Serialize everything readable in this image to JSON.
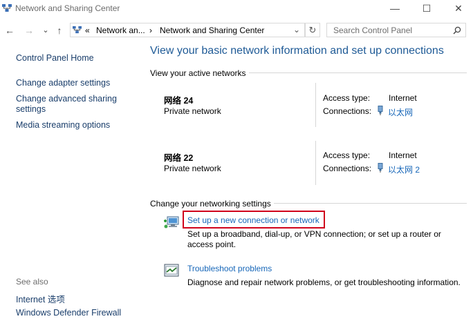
{
  "window": {
    "title": "Network and Sharing Center",
    "min_glyph": "—",
    "max_glyph": "☐",
    "close_glyph": "✕"
  },
  "nav": {
    "back_glyph": "←",
    "forward_glyph": "→",
    "recent_glyph": "⌄",
    "up_glyph": "↑",
    "address_prefix": "«",
    "breadcrumb_1": "Network an...",
    "sep": "›",
    "breadcrumb_2": "Network and Sharing Center",
    "dropdown_glyph": "⌄",
    "refresh_glyph": "↻",
    "search_placeholder": "Search Control Panel"
  },
  "sidebar": {
    "home": "Control Panel Home",
    "items": [
      "Change adapter settings",
      "Change advanced sharing settings",
      "Media streaming options"
    ],
    "see_also_label": "See also",
    "see_also": [
      "Internet 选项",
      "Windows Defender Firewall"
    ]
  },
  "main": {
    "heading": "View your basic network information and set up connections",
    "active_label": "View your active networks",
    "networks": [
      {
        "name": "网络 24",
        "type": "Private network",
        "access_label": "Access type:",
        "access": "Internet",
        "conn_label": "Connections:",
        "conn": "以太网"
      },
      {
        "name": "网络 22",
        "type": "Private network",
        "access_label": "Access type:",
        "access": "Internet",
        "conn_label": "Connections:",
        "conn": "以太网 2"
      }
    ],
    "settings_label": "Change your networking settings",
    "tasks": [
      {
        "title": "Set up a new connection or network",
        "desc": "Set up a broadband, dial-up, or VPN connection; or set up a router or access point."
      },
      {
        "title": "Troubleshoot problems",
        "desc": "Diagnose and repair network problems, or get troubleshooting information."
      }
    ]
  },
  "colors": {
    "heading": "#1e5a96",
    "link": "#1666b8",
    "highlight": "#d0021b"
  }
}
